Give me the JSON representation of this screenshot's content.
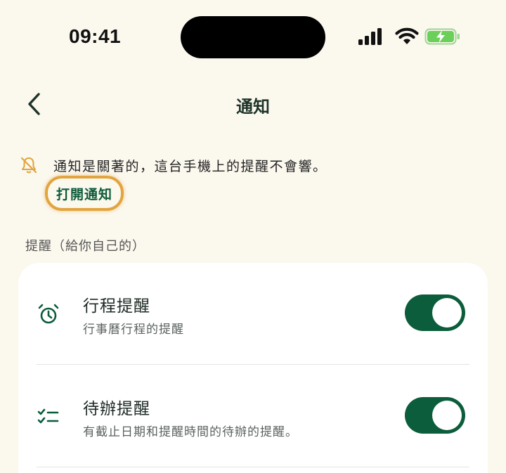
{
  "status_bar": {
    "time": "09:41"
  },
  "nav": {
    "title": "通知"
  },
  "notice": {
    "message": "通知是關著的，這台手機上的提醒不會響。",
    "action_label": "打開通知"
  },
  "section": {
    "header": "提醒（給你自己的）"
  },
  "reminders": [
    {
      "title": "行程提醒",
      "subtitle": "行事曆行程的提醒",
      "icon": "alarm-clock-icon",
      "enabled": true
    },
    {
      "title": "待辦提醒",
      "subtitle": "有截止日期和提醒時間的待辦的提醒。",
      "icon": "checklist-icon",
      "enabled": true
    }
  ],
  "colors": {
    "background": "#fbf8ee",
    "accent": "#0b5d3c",
    "highlight": "#e2a43e",
    "warning_icon": "#e2a43e",
    "battery_fill": "#6ccf5a"
  }
}
